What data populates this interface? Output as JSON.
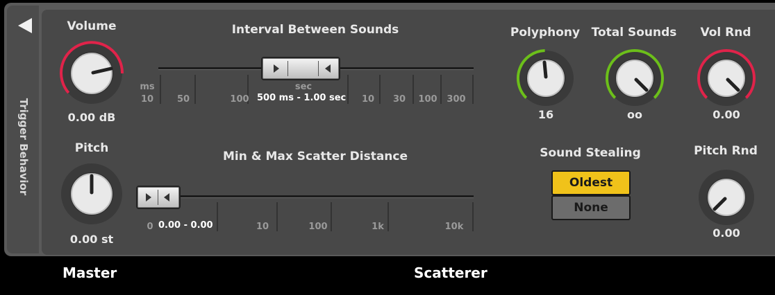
{
  "sidebar": {
    "label": "Trigger Behavior"
  },
  "volume": {
    "label": "Volume",
    "value": "0.00 dB",
    "color": "#e0234a"
  },
  "pitch": {
    "label": "Pitch",
    "value": "0.00 st"
  },
  "interval": {
    "label": "Interval Between Sounds",
    "range_value": "500 ms  - 1.00 sec",
    "ticks": [
      "10",
      "50",
      "100",
      "10",
      "30",
      "100",
      "300"
    ],
    "unit_ms": "ms",
    "unit_sec": "sec"
  },
  "scatter": {
    "label": "Min & Max Scatter Distance",
    "range_value": "0.00  -  0.00",
    "ticks": [
      "0",
      "10",
      "100",
      "1k",
      "10k"
    ]
  },
  "polyphony": {
    "label": "Polyphony",
    "value": "16",
    "color": "#6cbf1a"
  },
  "total_sounds": {
    "label": "Total Sounds",
    "value": "oo",
    "color": "#6cbf1a"
  },
  "vol_rnd": {
    "label": "Vol Rnd",
    "value": "0.00",
    "color": "#e0234a"
  },
  "pitch_rnd": {
    "label": "Pitch Rnd",
    "value": "0.00"
  },
  "sound_stealing": {
    "label": "Sound Stealing",
    "options": [
      "Oldest",
      "None"
    ],
    "selected": "Oldest",
    "accent": "#f0c21a"
  },
  "footer": {
    "master": "Master",
    "scatterer": "Scatterer"
  }
}
